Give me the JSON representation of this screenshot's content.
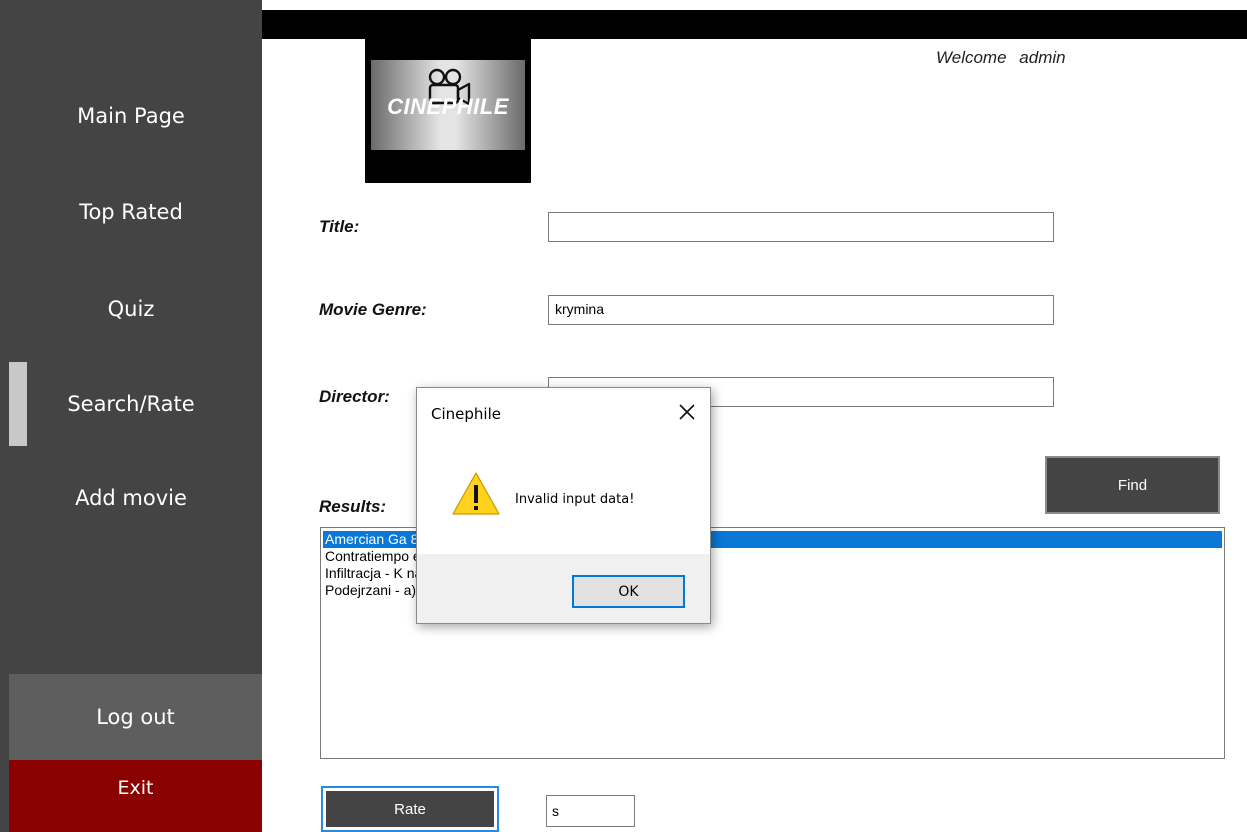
{
  "sidebar": {
    "items": [
      {
        "label": "Main Page"
      },
      {
        "label": "Top Rated"
      },
      {
        "label": "Quiz"
      },
      {
        "label": "Search/Rate"
      },
      {
        "label": "Add movie"
      }
    ],
    "active_item": "Search/Rate",
    "logout_label": "Log out",
    "exit_label": "Exit"
  },
  "logo": {
    "text": "CINEPHILE",
    "icon": "movie-camera-icon"
  },
  "header": {
    "welcome": "Welcome",
    "username": "admin"
  },
  "form": {
    "title_label": "Title:",
    "title_value": "",
    "genre_label": "Movie Genre:",
    "genre_value": "krymina",
    "director_label": "Director:",
    "director_value": "",
    "find_label": "Find",
    "results_label": "Results:",
    "results": [
      {
        "text": "Amercian Ga                                        8.5 (ocena) - 2 (liczba ocen)",
        "selected": true
      },
      {
        "text": "Contratiempo                                        ena) - 2 (liczba ocen)",
        "selected": false
      },
      {
        "text": "Infiltracja - K                                        na) - 0 (liczba ocen)",
        "selected": false
      },
      {
        "text": "Podejrzani -                                        a) - 0 (liczba ocen)",
        "selected": false
      }
    ],
    "rate_label": "Rate",
    "rate_value": "s"
  },
  "dialog": {
    "title": "Cinephile",
    "message": "Invalid input data!",
    "ok_label": "OK",
    "icon": "warning-icon"
  },
  "colors": {
    "sidebar": "#444444",
    "exit": "#8b0000",
    "logout": "#5e5e5e",
    "selection": "#0a78d7"
  }
}
